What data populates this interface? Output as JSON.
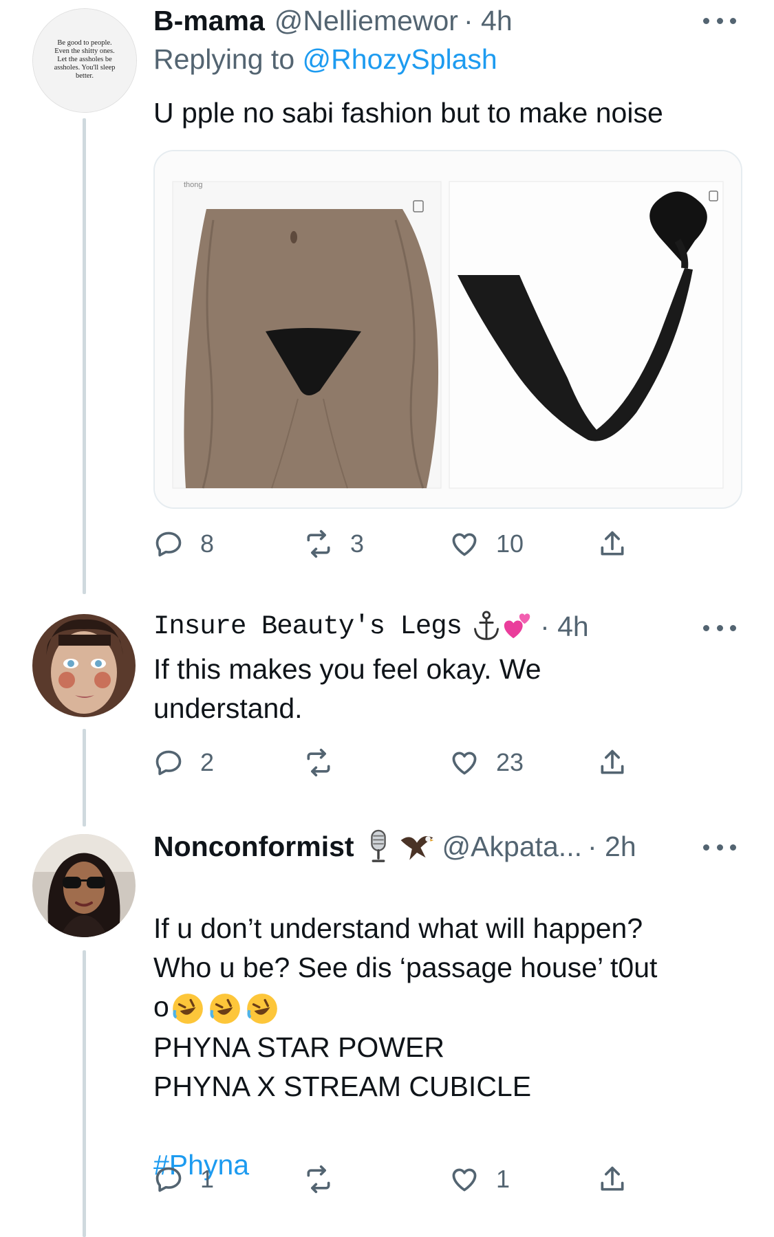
{
  "tweets": [
    {
      "name": "B-mama",
      "handle": "@Nelliemewor",
      "time": "· 4h",
      "replying_prefix": "Replying to",
      "replying_to": "@RhozySplash",
      "text": "U pple no sabi fashion but to make noise",
      "avatar_quote": "Be good to people. Even the shitty ones. Let the assholes be assholes. You'll sleep better.",
      "media_watermark": "thong",
      "replies": "8",
      "retweets": "3",
      "likes": "10"
    },
    {
      "name": "Insure Beauty's Legs",
      "name_emojis": [
        "anchor",
        "two-hearts"
      ],
      "time": "· 4h",
      "text": "If this makes you feel okay. We\nunderstand.",
      "replies": "2",
      "retweets": "",
      "likes": "23"
    },
    {
      "name": "Nonconformist",
      "name_emojis": [
        "microphone",
        "eagle"
      ],
      "handle": "@Akpata...",
      "time": "· 2h",
      "text": "If u don’t understand what will happen?\nWho u be? See dis ‘passage house’  t0ut\no",
      "text2": "PHYNA STAR POWER\nPHYNA X STREAM CUBICLE",
      "hashtag": "#Phyna",
      "replies": "1",
      "retweets": "",
      "likes": "1"
    }
  ],
  "colors": {
    "text": "#0f1419",
    "secondary": "#536471",
    "link": "#1d9bf0",
    "thread_line": "#cfd9de"
  }
}
